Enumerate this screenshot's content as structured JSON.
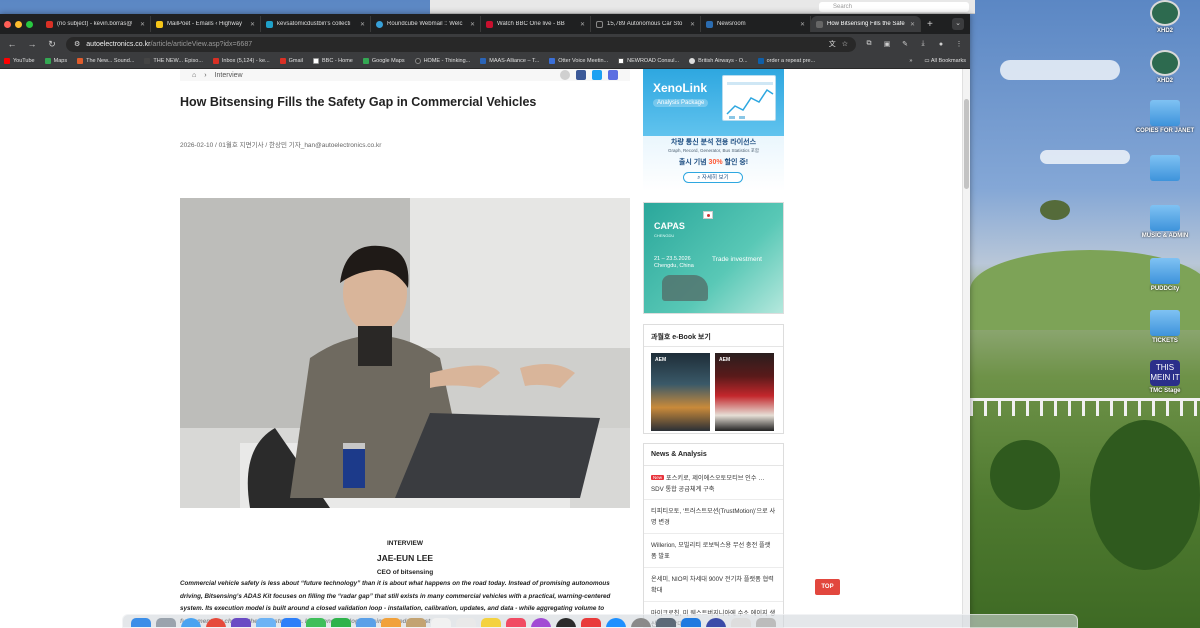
{
  "browser": {
    "tabs": [
      {
        "label": "(no subject) - kevin.borras@",
        "color": "#d93025",
        "active": false
      },
      {
        "label": "MailPoet - Emails ‹ Highway",
        "color": "#f5c518",
        "active": false
      },
      {
        "label": "kevsatomicdustbin's collecti",
        "color": "#1fa0c8",
        "active": false
      },
      {
        "label": "Roundcube Webmail :: Welc",
        "color": "#37a0d8",
        "active": false
      },
      {
        "label": "Watch BBC One live - BB",
        "color": "#c8102e",
        "active": false
      },
      {
        "label": "15,789 Autonomous Car Sto",
        "color": "#222222",
        "active": false
      },
      {
        "label": "Newsroom",
        "color": "#2b6cb0",
        "active": false
      },
      {
        "label": "How Bitsensing Fills the Safe",
        "color": "#666666",
        "active": true
      }
    ],
    "new_tab_symbol": "+",
    "url_host": "autoelectronics.co.kr",
    "url_path": "/article/articleView.asp?idx=6687",
    "bookmarks": [
      {
        "label": "YouTube",
        "color": "#ff0000"
      },
      {
        "label": "Maps",
        "color": "#34a853"
      },
      {
        "label": "The New... Sound...",
        "color": "#e05c2c"
      },
      {
        "label": "THE NEW... Episo...",
        "color": "#444444"
      },
      {
        "label": "Inbox (5,124) - ke...",
        "color": "#d93025"
      },
      {
        "label": "Gmail",
        "color": "#d93025"
      },
      {
        "label": "BBC - Home",
        "color": "#222222"
      },
      {
        "label": "Google Maps",
        "color": "#34a853"
      },
      {
        "label": "HOME - Thinking...",
        "color": "#333333"
      },
      {
        "label": "MAAS-Alliance – T...",
        "color": "#2a64b8"
      },
      {
        "label": "Otter Voice Meetin...",
        "color": "#3a6fd8"
      },
      {
        "label": "NEWROAD Consul...",
        "color": "#555555"
      },
      {
        "label": "British Airways - O...",
        "color": "#1b3a6b"
      },
      {
        "label": "order a repeat pre...",
        "color": "#0f5fa8"
      }
    ],
    "bookmarks_more": "»",
    "all_bookmarks": "All Bookmarks"
  },
  "finder": {
    "search_placeholder": "Search"
  },
  "article": {
    "breadcrumb": "Interview",
    "title": "How Bitsensing Fills the Safety Gap in Commercial Vehicles",
    "meta": "2026-02-10 / 01월호 지면기사   / 한상민 기자_han@autoelectronics.co.kr",
    "caption_kicker": "INTERVIEW",
    "caption_name": "JAE-EUN LEE",
    "caption_role": "CEO of bitsensing",
    "body": "Commercial vehicle safety is less about “future technology” than it is about what happens on the road today. Instead of promising autonomous driving, Bitsensing’s ADAS Kit focuses on filling the “radar gap” that still exists in many commercial vehicles with a practical, warning-centered system. Its execution model is built around a closed validation loop - installation, calibration, updates, and data - while aggregating volume to fundamentally change the cost structure. In the end, the logic is simple: reduce just one"
  },
  "sidebar": {
    "ad1": {
      "brand": "XenoLink",
      "sub": "Analysis Package",
      "line1": "차량 통신 분석 전용 라이선스",
      "line2": "Graph, Record, Generator, Bus Statistics 포함",
      "line3_pre": "출시 기념 ",
      "line3_hl": "30%",
      "line3_post": " 할인 중!",
      "button": "자세히 보기"
    },
    "ad2": {
      "brand": "CAPAS",
      "small": "CHENGDU",
      "date_line1": "21 – 23.5.2026",
      "date_line2": "Chengdu, China",
      "tagline": "Trade investment"
    },
    "ebook_heading": "과월호 e-Book 보기",
    "ebook_covers": [
      "AEM",
      "AEM"
    ],
    "news_heading": "News & Analysis",
    "new_badge": "New",
    "news": [
      "포스키로, 제이에스오토모티브 인수 … SDV 통합 공급체계 구축",
      "티피티오토, ‘트러스트모션(TrustMotion)’으로 사명 변경",
      "Willerion, 모빌리티 로보틱스용 무선 충전 플랫폼 발표",
      "온세미, NIO의 차세대 900V 전기차 플랫폼 협력 확대",
      "마이크로칩, 미 웨스트버지니아에 수소 에이지 생산 거점 확대"
    ]
  },
  "top_button": "TOP",
  "desktop_icons": [
    {
      "label": "XHD2",
      "kind": "disk"
    },
    {
      "label": "XHD2",
      "kind": "disk"
    },
    {
      "label": "COPIES FOR JANET",
      "kind": "folder"
    },
    {
      "label": "",
      "kind": "folder"
    },
    {
      "label": "MUSIC & ADMIN",
      "kind": "folder"
    },
    {
      "label": "PUDDCity",
      "kind": "folder"
    },
    {
      "label": "TICKETS",
      "kind": "folder"
    },
    {
      "label": "TMC Stage",
      "kind": "doc"
    }
  ],
  "desktop_doc_icon_text": "THIS MEIN IT",
  "colors": {
    "accent_red": "#e2473e",
    "tab_bar": "#1f2021",
    "toolbar": "#3b3c3e",
    "ad_blue": "#2ea7e0",
    "ad_teal": "#2aa79b"
  }
}
